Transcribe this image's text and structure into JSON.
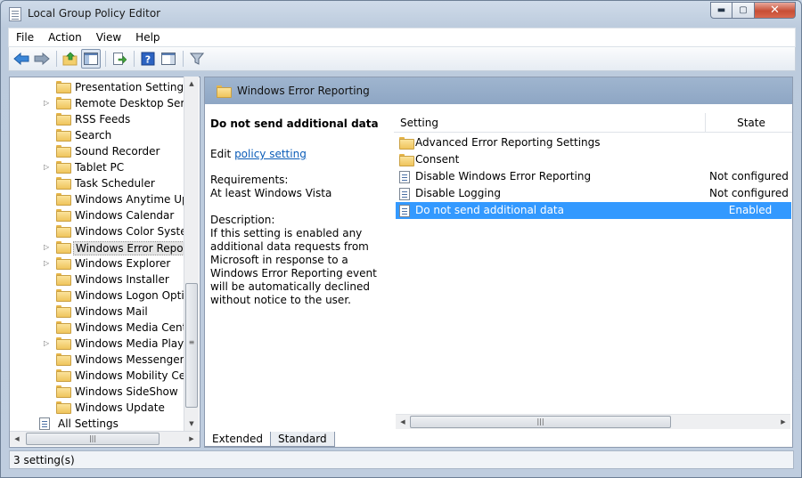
{
  "window": {
    "title": "Local Group Policy Editor"
  },
  "caption_buttons": {
    "minimize": "▬",
    "maximize": "▢",
    "close": "✕"
  },
  "menu": [
    "File",
    "Action",
    "View",
    "Help"
  ],
  "toolbar": {
    "buttons": [
      "back-icon",
      "forward-icon",
      "up-folder-icon",
      "show-hide-tree-icon",
      "export-list-icon",
      "help-icon",
      "show-action-pane-icon",
      "filter-icon"
    ]
  },
  "tree": {
    "items": [
      {
        "label": "Presentation Settings",
        "expandable": false
      },
      {
        "label": "Remote Desktop Services",
        "expandable": true
      },
      {
        "label": "RSS Feeds",
        "expandable": false
      },
      {
        "label": "Search",
        "expandable": false
      },
      {
        "label": "Sound Recorder",
        "expandable": false
      },
      {
        "label": "Tablet PC",
        "expandable": true
      },
      {
        "label": "Task Scheduler",
        "expandable": false
      },
      {
        "label": "Windows Anytime Upgrade",
        "expandable": false
      },
      {
        "label": "Windows Calendar",
        "expandable": false
      },
      {
        "label": "Windows Color System",
        "expandable": false
      },
      {
        "label": "Windows Error Reporting",
        "expandable": true,
        "selected": true
      },
      {
        "label": "Windows Explorer",
        "expandable": true
      },
      {
        "label": "Windows Installer",
        "expandable": false
      },
      {
        "label": "Windows Logon Options",
        "expandable": false
      },
      {
        "label": "Windows Mail",
        "expandable": false
      },
      {
        "label": "Windows Media Center",
        "expandable": false
      },
      {
        "label": "Windows Media Player",
        "expandable": true
      },
      {
        "label": "Windows Messenger",
        "expandable": false
      },
      {
        "label": "Windows Mobility Center",
        "expandable": false
      },
      {
        "label": "Windows SideShow",
        "expandable": false
      },
      {
        "label": "Windows Update",
        "expandable": false
      }
    ],
    "root_item": "All Settings",
    "scroll_grip": "|||"
  },
  "right_pane": {
    "header_title": "Windows Error Reporting",
    "extended": {
      "title": "Do not send additional data",
      "edit_prefix": "Edit ",
      "edit_link": "policy setting",
      "requirements_label": "Requirements:",
      "requirements_value": "At least Windows Vista",
      "description_label": "Description:",
      "description": "If this setting is enabled any additional data requests from Microsoft in response to a Windows Error Reporting event will be automatically declined without notice to the user."
    },
    "columns": {
      "setting": "Setting",
      "state": "State"
    },
    "rows": [
      {
        "name": "Advanced Error Reporting Settings",
        "state": "",
        "type": "folder"
      },
      {
        "name": "Consent",
        "state": "",
        "type": "folder"
      },
      {
        "name": "Disable Windows Error Reporting",
        "state": "Not configured",
        "type": "setting"
      },
      {
        "name": "Disable Logging",
        "state": "Not configured",
        "type": "setting"
      },
      {
        "name": "Do not send additional data",
        "state": "Enabled",
        "type": "setting",
        "selected": true
      }
    ],
    "scroll_grip": "|||"
  },
  "tabs": [
    "Extended",
    "Standard"
  ],
  "status": "3 setting(s)",
  "colors": {
    "selection": "#3399ff",
    "header_band": "#8ea6c4",
    "link": "#0b5cb8"
  }
}
